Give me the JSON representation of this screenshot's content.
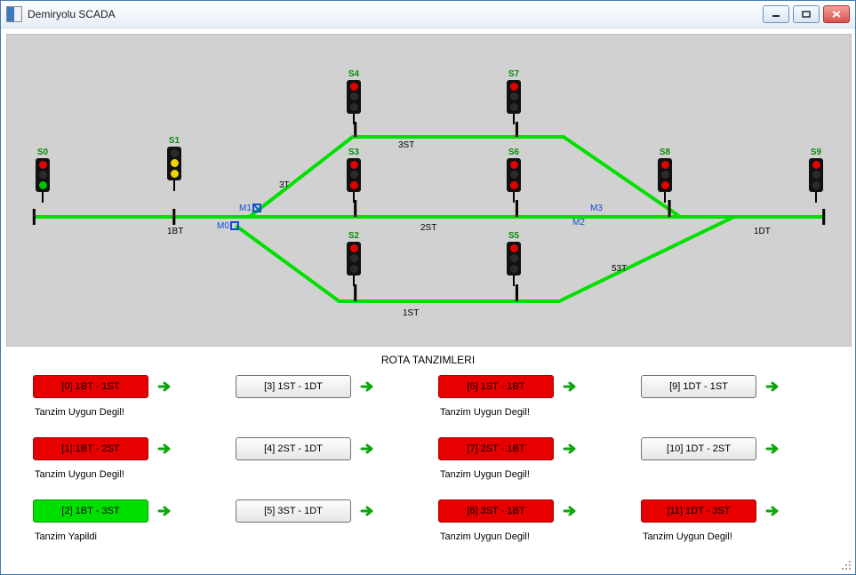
{
  "window": {
    "title": "Demiryolu SCADA"
  },
  "panel_title": "ROTA TANZIMLERI",
  "signals": {
    "S0": {
      "label": "S0",
      "top": "red",
      "mid": "off",
      "bot": "green"
    },
    "S1": {
      "label": "S1",
      "top": "off",
      "mid": "yellow",
      "bot": "yellow"
    },
    "S2": {
      "label": "S2",
      "top": "red",
      "mid": "off",
      "bot": "off"
    },
    "S3": {
      "label": "S3",
      "top": "red",
      "mid": "off",
      "bot": "red"
    },
    "S4": {
      "label": "S4",
      "top": "red",
      "mid": "off",
      "bot": "off"
    },
    "S5": {
      "label": "S5",
      "top": "red",
      "mid": "off",
      "bot": "off"
    },
    "S6": {
      "label": "S6",
      "top": "red",
      "mid": "off",
      "bot": "red"
    },
    "S7": {
      "label": "S7",
      "top": "red",
      "mid": "off",
      "bot": "off"
    },
    "S8": {
      "label": "S8",
      "top": "red",
      "mid": "off",
      "bot": "red"
    },
    "S9": {
      "label": "S9",
      "top": "red",
      "mid": "off",
      "bot": "off"
    }
  },
  "segments": {
    "t1bt": "1BT",
    "t3t": "3T",
    "t3st": "3ST",
    "t2st": "2ST",
    "t1st": "1ST",
    "t53t": "53T",
    "t1dt": "1DT"
  },
  "markers": {
    "M0": "M0",
    "M1": "M1",
    "M2": "M2",
    "M3": "M3"
  },
  "status_text": {
    "fail": "Tanzim Uygun Degil!",
    "ok": "Tanzim Yapildi"
  },
  "routes": [
    {
      "id": "r0",
      "label": "[0]  1BT - 1ST",
      "color": "red",
      "status": "fail"
    },
    {
      "id": "r1",
      "label": "[1]  1BT - 2ST",
      "color": "red",
      "status": "fail"
    },
    {
      "id": "r2",
      "label": "[2]  1BT - 3ST",
      "color": "green",
      "status": "ok"
    },
    {
      "id": "r3",
      "label": "[3]  1ST - 1DT",
      "color": "gray",
      "status": ""
    },
    {
      "id": "r4",
      "label": "[4]  2ST - 1DT",
      "color": "gray",
      "status": ""
    },
    {
      "id": "r5",
      "label": "[5]  3ST - 1DT",
      "color": "gray",
      "status": ""
    },
    {
      "id": "r6",
      "label": "[6]  1ST - 1BT",
      "color": "red",
      "status": "fail"
    },
    {
      "id": "r7",
      "label": "[7]  2ST - 1BT",
      "color": "red",
      "status": "fail"
    },
    {
      "id": "r8",
      "label": "[8]  3ST - 1BT",
      "color": "red",
      "status": "fail"
    },
    {
      "id": "r9",
      "label": "[9]  1DT - 1ST",
      "color": "gray",
      "status": ""
    },
    {
      "id": "r10",
      "label": "[10]  1DT - 2ST",
      "color": "gray",
      "status": ""
    },
    {
      "id": "r11",
      "label": "[11]  1DT - 3ST",
      "color": "red",
      "status": "fail"
    }
  ],
  "colors": {
    "track": "#00e000"
  }
}
